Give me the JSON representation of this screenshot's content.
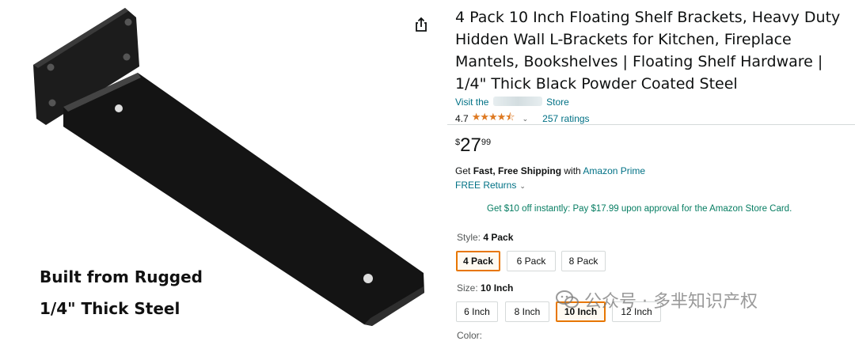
{
  "product": {
    "title": "4 Pack 10 Inch Floating Shelf Brackets, Heavy Duty Hidden Wall L-Brackets for Kitchen, Fireplace Mantels, Bookshelves | Floating Shelf Hardware | 1/4\" Thick Black Powder Coated Steel",
    "store_prefix": "Visit the",
    "store_suffix": "Store",
    "rating_value": "4.7",
    "rating_stars": 4.7,
    "ratings_count": "257 ratings"
  },
  "image": {
    "caption_line1": "Built from Rugged",
    "caption_line2": "1/4\" Thick Steel",
    "share_icon": "share-icon"
  },
  "price": {
    "symbol": "$",
    "whole": "27",
    "fraction": "99"
  },
  "shipping": {
    "prefix": "Get ",
    "bold": "Fast, Free Shipping",
    "middle": " with ",
    "prime": "Amazon Prime",
    "returns": "FREE Returns"
  },
  "promo": "Get $10 off instantly: Pay $17.99 upon approval for the Amazon Store Card.",
  "style_option": {
    "label": "Style:",
    "selected": "4 Pack",
    "options": [
      "4 Pack",
      "6 Pack",
      "8 Pack"
    ]
  },
  "size_option": {
    "label": "Size:",
    "selected": "10 Inch",
    "options": [
      "6 Inch",
      "8 Inch",
      "10 Inch",
      "12 Inch"
    ]
  },
  "next_option_partial": "Color:",
  "watermark": "公众号 · 多芈知识产权",
  "colors": {
    "link": "#007185",
    "star": "#de7921",
    "selected_border": "#e77600",
    "promo": "#067d62"
  }
}
